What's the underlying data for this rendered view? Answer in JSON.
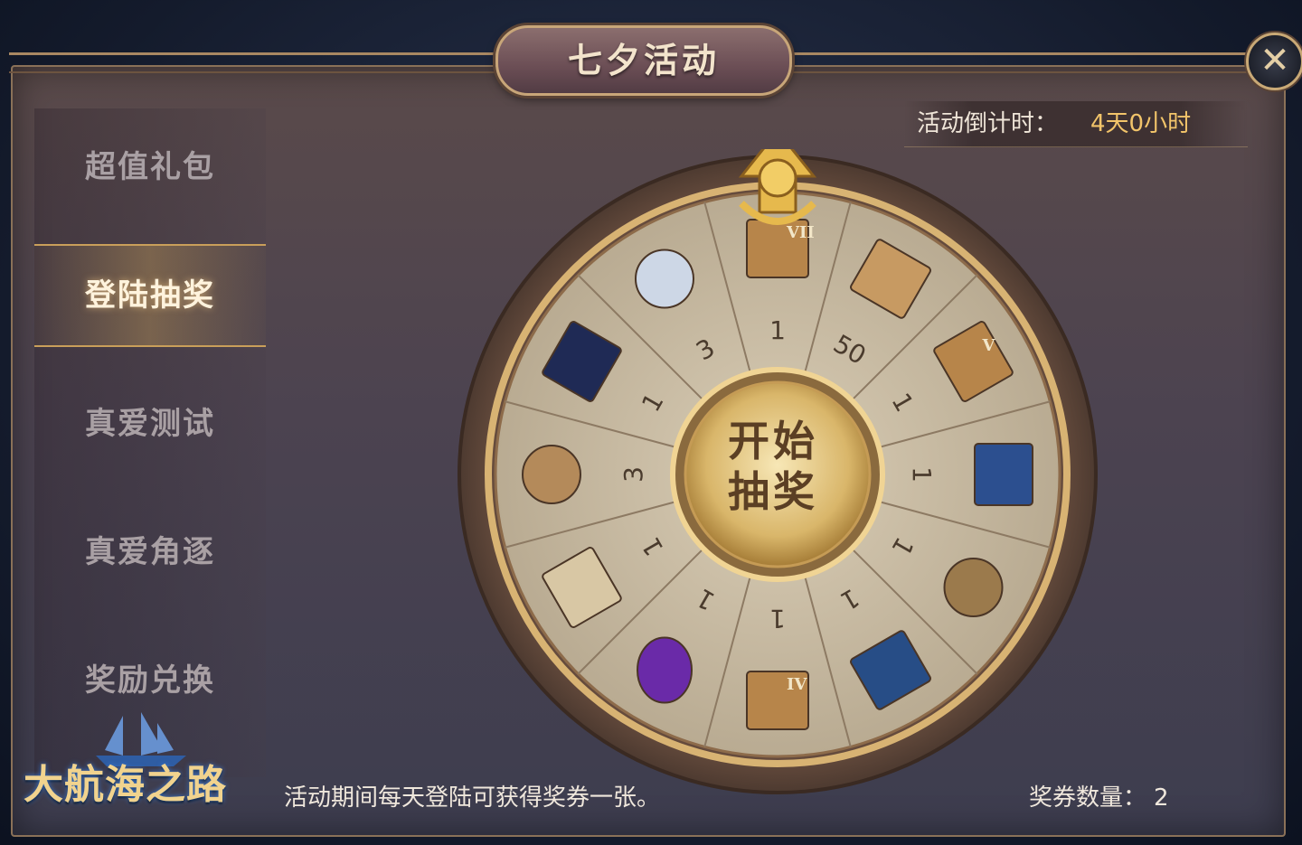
{
  "window": {
    "title": "七夕活动",
    "close_label": "✕"
  },
  "sidebar": {
    "items": [
      {
        "label": "超值礼包",
        "active": false
      },
      {
        "label": "登陆抽奖",
        "active": true
      },
      {
        "label": "真爱测试",
        "active": false
      },
      {
        "label": "真爱角逐",
        "active": false
      },
      {
        "label": "奖励兑换",
        "active": false
      }
    ]
  },
  "countdown": {
    "label": "活动倒计时：",
    "value": "4天0小时"
  },
  "wheel": {
    "spin_label_line1": "开始",
    "spin_label_line2": "抽奖",
    "prizes": [
      {
        "icon": "crate-vii-icon",
        "quantity": "1",
        "box_roman": "VII"
      },
      {
        "icon": "wood-planks-icon",
        "quantity": "50"
      },
      {
        "icon": "crate-v-icon",
        "quantity": "1",
        "box_roman": "V"
      },
      {
        "icon": "blue-book-icon",
        "quantity": "1"
      },
      {
        "icon": "compass-ring-icon",
        "quantity": "1"
      },
      {
        "icon": "blueprint-book-icon",
        "quantity": "1"
      },
      {
        "icon": "crate-iv-icon",
        "quantity": "1",
        "box_roman": "IV"
      },
      {
        "icon": "purple-gem-icon",
        "quantity": "1"
      },
      {
        "icon": "scroll-icon",
        "quantity": "1"
      },
      {
        "icon": "coin-sack-icon",
        "quantity": "3"
      },
      {
        "icon": "golden-card-icon",
        "quantity": "1"
      },
      {
        "icon": "crystal-ball-book-icon",
        "quantity": "3"
      }
    ]
  },
  "footer": {
    "note": "活动期间每天登陆可获得奖券一张。",
    "ticket_label": "奖券数量：",
    "ticket_count": "2"
  },
  "logo": {
    "text": "大航海之路"
  },
  "colors": {
    "gold": "#f2c46a",
    "frame": "#c8a679",
    "panel": "#4c4350"
  }
}
